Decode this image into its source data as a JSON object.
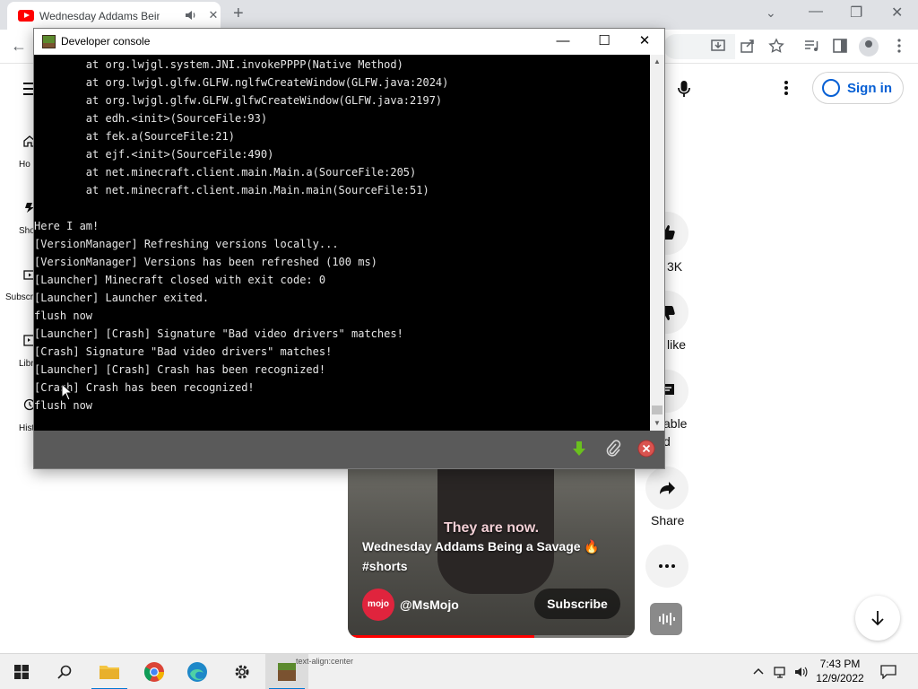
{
  "browser": {
    "tab": {
      "title": "Wednesday Addams Being a Savage",
      "close_glyph": "✕"
    },
    "new_tab_glyph": "+",
    "tab_search_glyph": "⌄",
    "window_controls": {
      "minimize": "—",
      "restore": "❐",
      "close": "✕"
    },
    "back_glyph": "←"
  },
  "youtube": {
    "sign_in": "Sign in",
    "sidebar": [
      {
        "label": "Ho",
        "icon": "home-icon"
      },
      {
        "label": "Sho",
        "icon": "shorts-icon"
      },
      {
        "label": "Subscri",
        "icon": "subscriptions-icon"
      },
      {
        "label": "Libr",
        "icon": "library-icon"
      },
      {
        "label": "Hist",
        "icon": "history-icon"
      }
    ],
    "actions": {
      "like_label": "3K",
      "dislike_label": "like",
      "comments_label_1": "able",
      "comments_label_2": "d",
      "share_label": "Share"
    },
    "short": {
      "caption": "They are now.",
      "title": "Wednesday Addams Being a Savage 🔥 #shorts",
      "channel": "@MsMojo",
      "avatar_text": "mojo",
      "subscribe": "Subscribe",
      "progress_fraction": 0.65
    }
  },
  "dev_console": {
    "title": "Developer console",
    "controls": {
      "minimize": "—",
      "maximize": "☐",
      "close": "✕"
    },
    "lines": [
      "        at org.lwjgl.system.JNI.invokePPPP(Native Method)",
      "        at org.lwjgl.glfw.GLFW.nglfwCreateWindow(GLFW.java:2024)",
      "        at org.lwjgl.glfw.GLFW.glfwCreateWindow(GLFW.java:2197)",
      "        at edh.<init>(SourceFile:93)",
      "        at fek.a(SourceFile:21)",
      "        at ejf.<init>(SourceFile:490)",
      "        at net.minecraft.client.main.Main.a(SourceFile:205)",
      "        at net.minecraft.client.main.Main.main(SourceFile:51)",
      "",
      "Here I am!",
      "[VersionManager] Refreshing versions locally...",
      "[VersionManager] Versions has been refreshed (100 ms)",
      "[Launcher] Minecraft closed with exit code: 0",
      "[Launcher] Launcher exited.",
      "flush now",
      "[Launcher] [Crash] Signature \"Bad video drivers\" matches!",
      "[Crash] Signature \"Bad video drivers\" matches!",
      "[Launcher] [Crash] Crash has been recognized!",
      "[Crash] Crash has been recognized!",
      "flush now"
    ],
    "footer_icons": [
      "download-icon",
      "attach-icon",
      "close-circle-icon"
    ]
  },
  "taskbar": {
    "apps": [
      "start-icon",
      "search-icon",
      "file-explorer-icon",
      "chrome-icon",
      "edge-icon",
      "settings-icon",
      "minecraft-launcher-icon"
    ],
    "tooltip_text": "text-align:center",
    "time": "7:43 PM",
    "date": "12/9/2022"
  },
  "colors": {
    "youtube_red": "#ff0000",
    "signin_blue": "#065fd4",
    "console_bg": "#000000",
    "console_text": "#e6e6e6",
    "taskbar_accent": "#0078d4"
  }
}
